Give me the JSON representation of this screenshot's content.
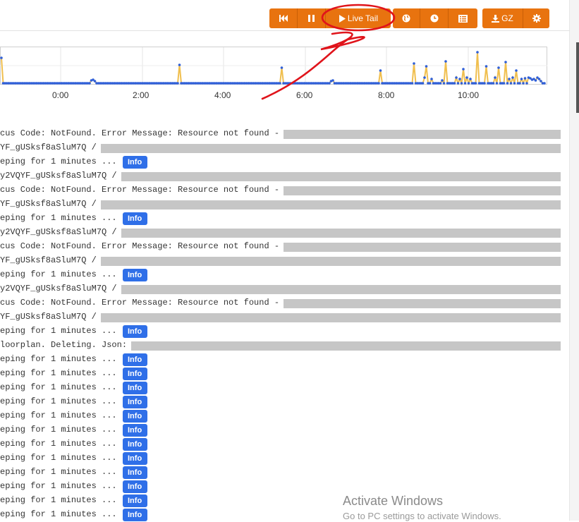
{
  "toolbar": {
    "live_tail_label": "Live Tail",
    "export_label": "GZ",
    "icons": [
      "rewind-icon",
      "pause-icon",
      "play-icon",
      "globe-icon",
      "clock-icon",
      "list-icon",
      "download-icon",
      "gear-icon"
    ],
    "accent_color": "#e8730f"
  },
  "chart_data": {
    "type": "line",
    "x_tick_labels": [
      "0:00",
      "2:00",
      "4:00",
      "6:00",
      "8:00",
      "10:00"
    ],
    "series_color": "#f0bf4f",
    "point_color": "#2f5fd8",
    "grid": true
  },
  "log": {
    "rows": [
      {
        "text": "cus Code: NotFound. Error Message: Resource not found -",
        "badge": ""
      },
      {
        "text": "YF_gUSksf8aSluM7Q /",
        "badge": ""
      },
      {
        "text": "eping for 1 minutes ...",
        "badge": "Info"
      },
      {
        "text": "y2VQYF_gUSksf8aSluM7Q /",
        "badge": ""
      },
      {
        "text": "cus Code: NotFound. Error Message: Resource not found -",
        "badge": ""
      },
      {
        "text": "YF_gUSksf8aSluM7Q /",
        "badge": ""
      },
      {
        "text": "eping for 1 minutes ...",
        "badge": "Info"
      },
      {
        "text": "y2VQYF_gUSksf8aSluM7Q /",
        "badge": ""
      },
      {
        "text": "cus Code: NotFound. Error Message: Resource not found -",
        "badge": ""
      },
      {
        "text": "YF_gUSksf8aSluM7Q /",
        "badge": ""
      },
      {
        "text": "eping for 1 minutes ...",
        "badge": "Info"
      },
      {
        "text": "y2VQYF_gUSksf8aSluM7Q /",
        "badge": ""
      },
      {
        "text": "cus Code: NotFound. Error Message: Resource not found -",
        "badge": ""
      },
      {
        "text": "YF_gUSksf8aSluM7Q /",
        "badge": ""
      },
      {
        "text": "eping for 1 minutes ...",
        "badge": "Info"
      },
      {
        "text": "loorplan. Deleting. Json:",
        "badge": ""
      },
      {
        "text": "eping for 1 minutes ...",
        "badge": "Info"
      },
      {
        "text": "eping for 1 minutes ...",
        "badge": "Info"
      },
      {
        "text": "eping for 1 minutes ...",
        "badge": "Info"
      },
      {
        "text": "eping for 1 minutes ...",
        "badge": "Info"
      },
      {
        "text": "eping for 1 minutes ...",
        "badge": "Info"
      },
      {
        "text": "eping for 1 minutes ...",
        "badge": "Info"
      },
      {
        "text": "eping for 1 minutes ...",
        "badge": "Info"
      },
      {
        "text": "eping for 1 minutes ...",
        "badge": "Info"
      },
      {
        "text": "eping for 1 minutes ...",
        "badge": "Info"
      },
      {
        "text": "eping for 1 minutes ...",
        "badge": "Info"
      },
      {
        "text": "eping for 1 minutes ...",
        "badge": "Info"
      },
      {
        "text": "eping for 1 minutes ...",
        "badge": "Info"
      }
    ]
  },
  "watermark": {
    "line1": "Activate Windows",
    "line2": "Go to PC settings to activate Windows."
  }
}
